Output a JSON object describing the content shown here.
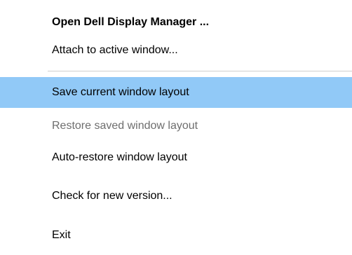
{
  "menu": {
    "items": [
      {
        "label": "Open Dell Display Manager ..."
      },
      {
        "label": "Attach to active window..."
      },
      {
        "label": "Save current window layout"
      },
      {
        "label": "Restore saved window layout"
      },
      {
        "label": "Auto-restore window layout"
      },
      {
        "label": "Check for new version..."
      },
      {
        "label": "Exit"
      }
    ]
  },
  "colors": {
    "highlight": "#91c9f7",
    "disabled_text": "#6e6e6e",
    "separator": "#cfcfcf"
  }
}
